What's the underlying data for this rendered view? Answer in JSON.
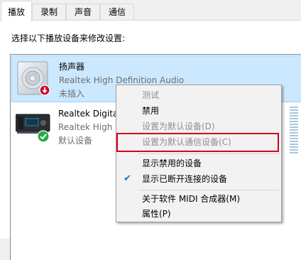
{
  "tabs": [
    {
      "label": "播放",
      "active": true
    },
    {
      "label": "录制",
      "active": false
    },
    {
      "label": "声音",
      "active": false
    },
    {
      "label": "通信",
      "active": false
    }
  ],
  "instruction": "选择以下播放设备来修改设置:",
  "devices": [
    {
      "name": "扬声器",
      "description": "Realtek High Definition Audio",
      "status": "未插入",
      "icon": "speaker-icon",
      "badge": "unplugged-badge-icon",
      "selected": true
    },
    {
      "name": "Realtek Digital",
      "description": "Realtek High D",
      "status": "默认设备",
      "icon": "digital-output-device-icon",
      "badge": "default-check-badge-icon",
      "selected": false
    }
  ],
  "context_menu": {
    "items": [
      {
        "label": "测试",
        "disabled": true
      },
      {
        "label": "禁用",
        "disabled": false
      },
      {
        "label": "设置为默认设备(D)",
        "disabled": true
      },
      {
        "label": "设置为默认通信设备(C)",
        "disabled": true,
        "highlighted": true
      },
      {
        "label": "显示禁用的设备",
        "disabled": false
      },
      {
        "label": "显示已断开连接的设备",
        "disabled": false,
        "checked": true
      },
      {
        "label": "关于软件 MIDI 合成器(M)",
        "disabled": false
      },
      {
        "label": "属性(P)",
        "disabled": false
      }
    ]
  },
  "colors": {
    "selection": "#cce8ff",
    "check": "#0078d7",
    "highlight_box": "#d6001c",
    "default_badge": "#2ba84a"
  }
}
